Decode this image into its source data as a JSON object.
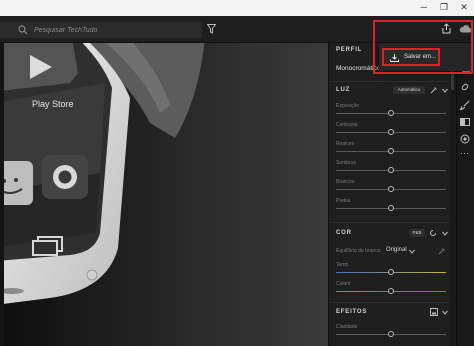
{
  "header": {
    "search_placeholder": "Pesquisar TechTudo"
  },
  "photo": {
    "app_label": "Play Store"
  },
  "export_menu": {
    "save_as_label": "Salvar em..."
  },
  "panel": {
    "profile": {
      "heading": "PERFIL",
      "value": "Monocromático"
    },
    "light": {
      "heading": "LUZ",
      "auto_label": "Automático",
      "sliders": [
        {
          "label": "Exposição",
          "value": 0
        },
        {
          "label": "Contraste",
          "value": 0
        },
        {
          "label": "Realces",
          "value": 0
        },
        {
          "label": "Sombras",
          "value": 0
        },
        {
          "label": "Brancos",
          "value": 0
        },
        {
          "label": "Pretos",
          "value": 0
        }
      ]
    },
    "color": {
      "heading": "COR",
      "bw_label": "P&B",
      "white_balance_label": "Equilíbrio de branco",
      "white_balance_value": "Original",
      "sliders": [
        {
          "label": "Temp",
          "value": 0
        },
        {
          "label": "Colorir",
          "value": 0
        }
      ]
    },
    "effects": {
      "heading": "EFEITOS",
      "sliders": [
        {
          "label": "Claridade",
          "value": 0
        }
      ]
    }
  },
  "colors": {
    "highlight": "#e0202c",
    "panel_bg": "#1f1f1f",
    "header_bg": "#1e1e1e"
  }
}
